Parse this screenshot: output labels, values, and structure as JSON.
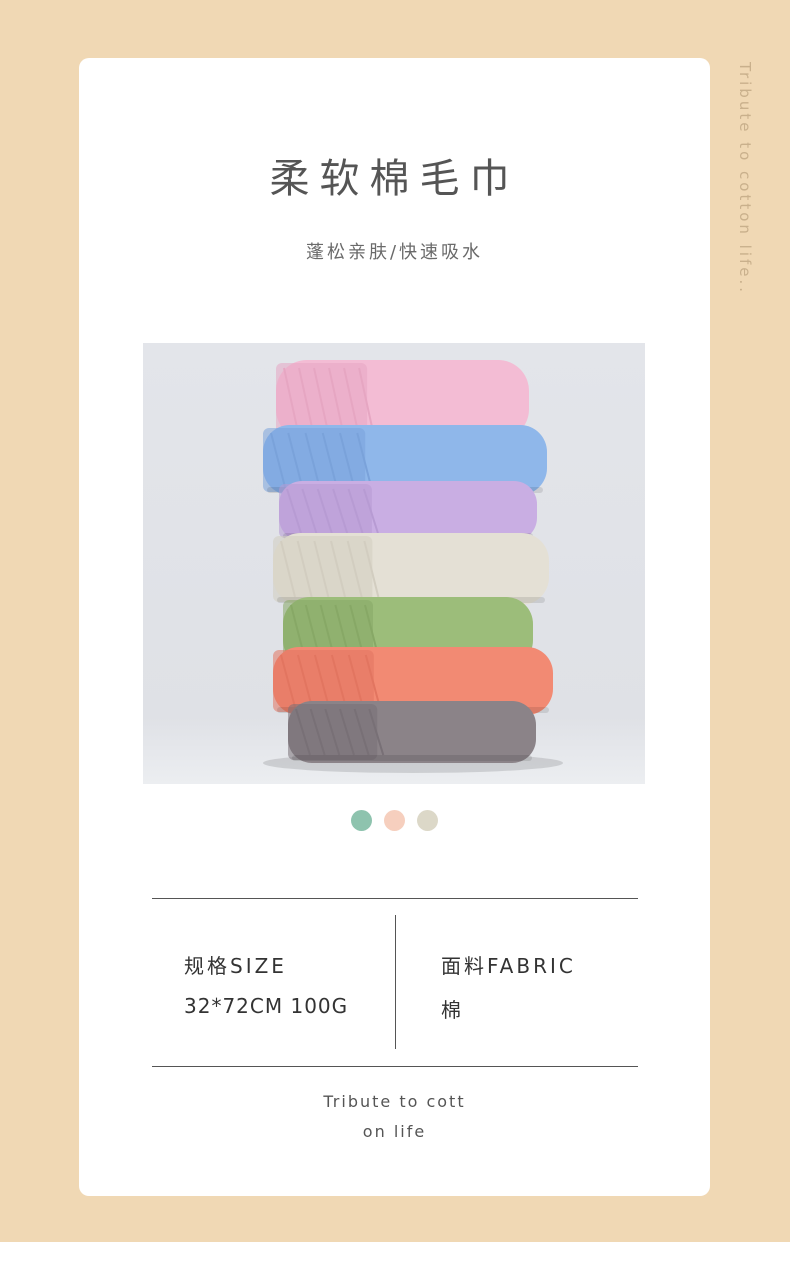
{
  "side_caption": "Tribute to cotton life..",
  "title": "柔软棉毛巾",
  "subtitle": "蓬松亲肤/快速吸水",
  "photo": {
    "towels": [
      {
        "color": "#f3bcd4",
        "shade": "#e6a6c2"
      },
      {
        "color": "#8fb7ea",
        "shade": "#7aa2da"
      },
      {
        "color": "#c9aee3",
        "shade": "#b79bd3"
      },
      {
        "color": "#e4e0d5",
        "shade": "#d2cdc0"
      },
      {
        "color": "#9cbd7a",
        "shade": "#87a866"
      },
      {
        "color": "#f28a73",
        "shade": "#e27560"
      },
      {
        "color": "#8b8388",
        "shade": "#787076"
      }
    ]
  },
  "swatches": [
    {
      "name": "green",
      "color": "#8ec3ae"
    },
    {
      "name": "peach",
      "color": "#f6cfbe"
    },
    {
      "name": "beige",
      "color": "#dcd8c8"
    }
  ],
  "specs": {
    "size_label": "规格SIZE",
    "size_value": "32*72CM  100G",
    "fabric_label": "面料FABRIC",
    "fabric_value": "棉"
  },
  "tagline": {
    "line1": "Tribute to cott",
    "line2": "on life"
  }
}
